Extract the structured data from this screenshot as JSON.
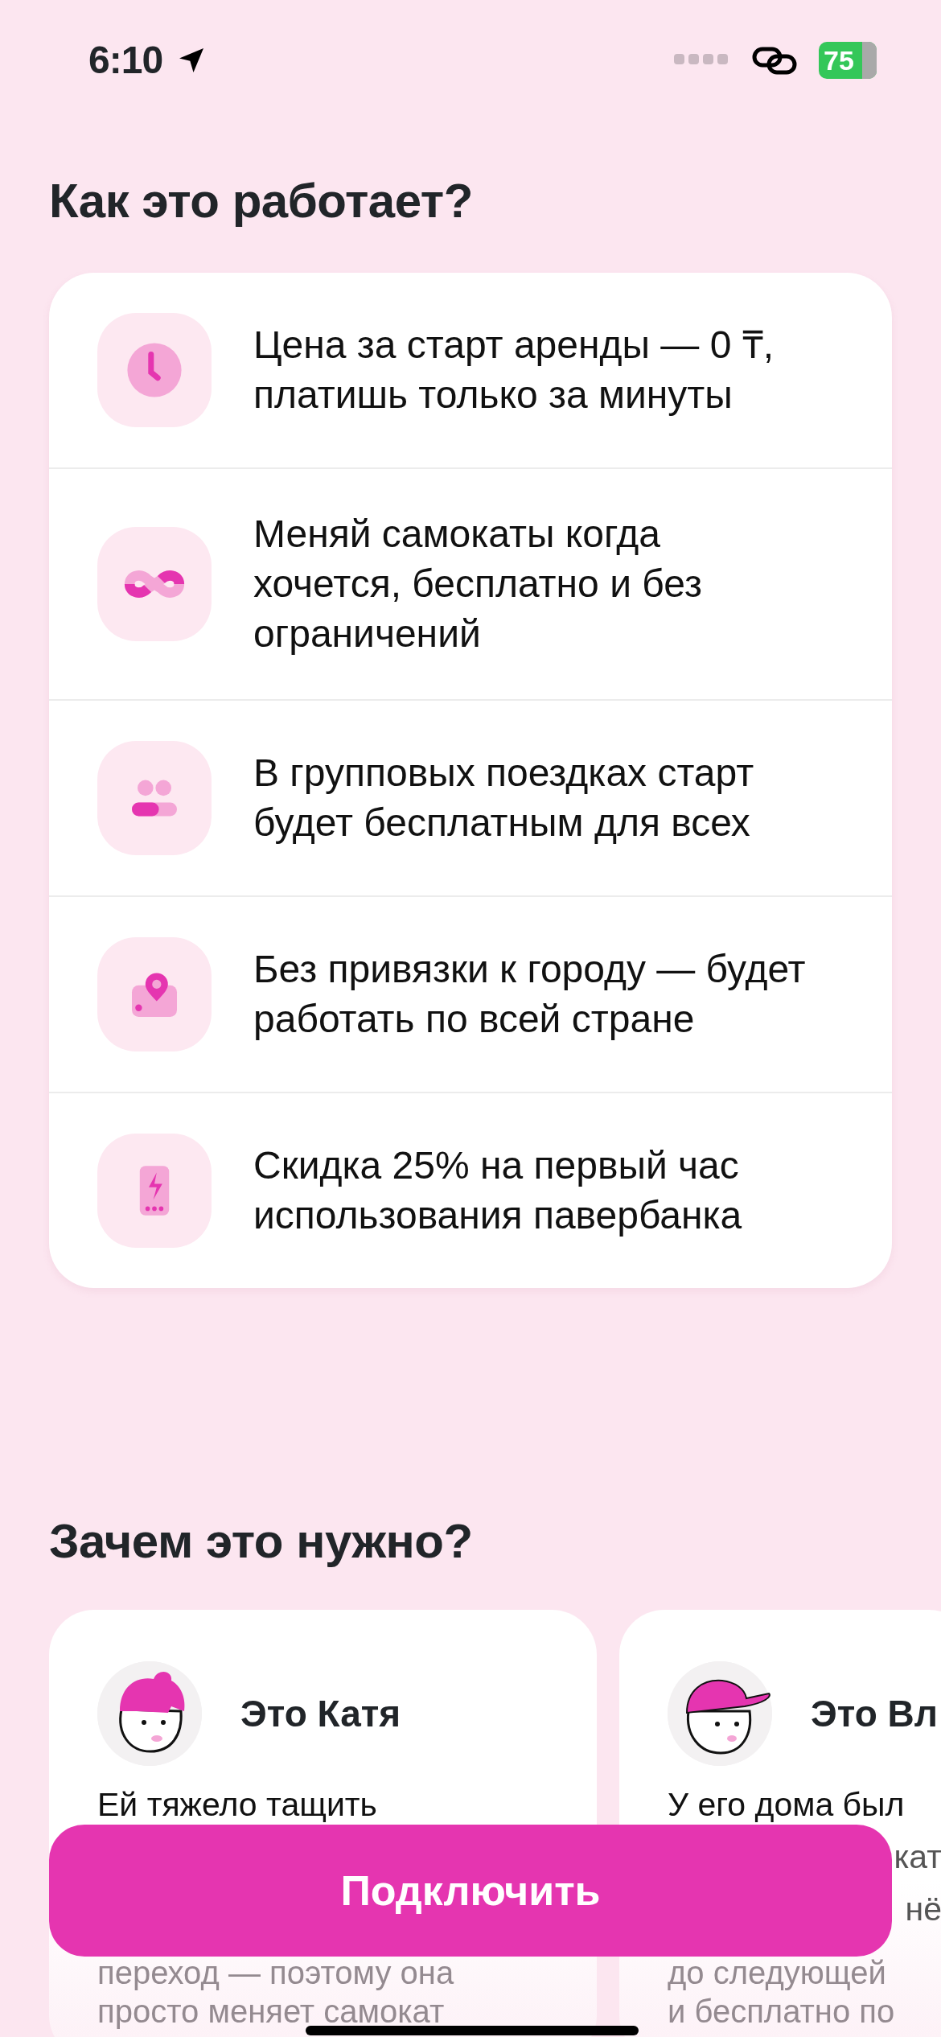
{
  "status_bar": {
    "time": "6:10",
    "battery": "75"
  },
  "how_it_works": {
    "title": "Как это работает?",
    "items": [
      {
        "kind": "clock",
        "text": "Цена за старт аренды — 0 ₸, платишь только за минуты"
      },
      {
        "kind": "infinity",
        "text": "Меняй самокаты когда хочется, бесплатно и без ограничений"
      },
      {
        "kind": "group",
        "text": "В групповых поездках старт будет бесплатным для всех"
      },
      {
        "kind": "map",
        "text": "Без привязки к городу — будет работать по всей стране"
      },
      {
        "kind": "powerbank",
        "text": "Скидка 25% на первый час использования павербанка"
      }
    ]
  },
  "why": {
    "title": "Зачем это нужно?",
    "cards": [
      {
        "kind": "girl",
        "name": "Это Катя",
        "top_lines": [
          "Ей тяжело тащить"
        ],
        "bottom_lines": [
          "переход — поэтому она",
          "просто меняет самокат"
        ]
      },
      {
        "kind": "boy",
        "name": "Это Вл",
        "top_lines": [
          "У его дома был"
        ],
        "side_lines": [
          "кат",
          "нё"
        ],
        "bottom_lines": [
          "до следующей",
          "и бесплатно по"
        ]
      }
    ]
  },
  "connect_button": "Подключить"
}
